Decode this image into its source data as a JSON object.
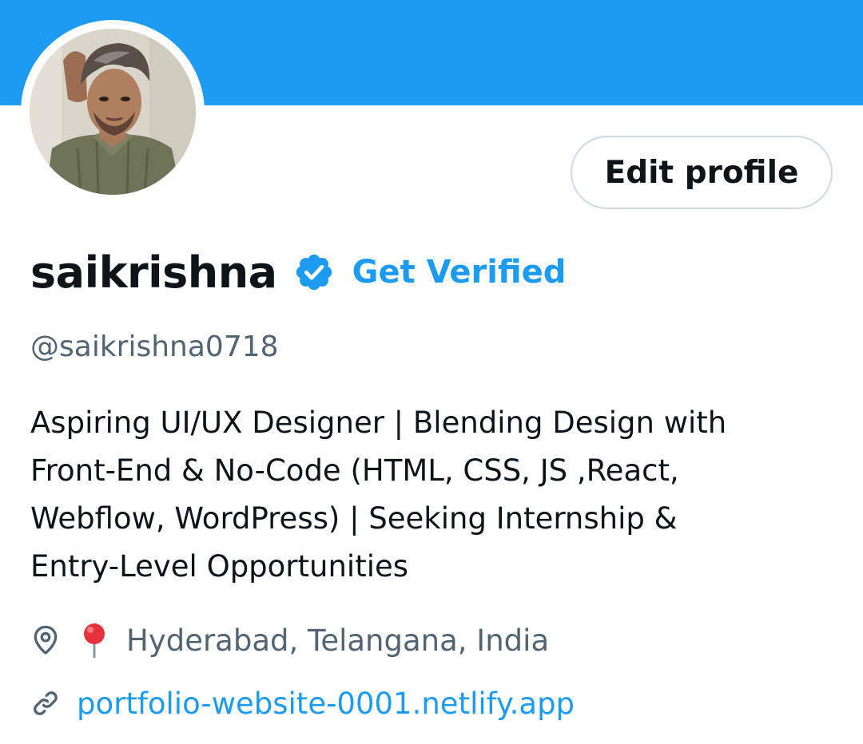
{
  "profile": {
    "display_name": "saikrishna",
    "get_verified_label": "Get Verified",
    "handle": "@saikrishna0718",
    "edit_profile_label": "Edit profile",
    "bio_lines": [
      "Aspiring UI/UX Designer | Blending Design with",
      "Front-End & No-Code (HTML, CSS, JS ,React,",
      "Webflow, WordPress) | Seeking Internship &",
      "Entry-Level Opportunities"
    ],
    "location": "Hyderabad, Telangana, India",
    "website": "portfolio-website-0001.netlify.app"
  },
  "icons": {
    "verified": "verified-badge-icon",
    "location": "location-pin-outline-icon",
    "location_emoji": "round-pushpin-emoji",
    "link": "link-chain-icon"
  },
  "colors": {
    "banner": "#1d9bf0",
    "accent": "#1d9bf0",
    "text_primary": "#0f1419",
    "text_secondary": "#536471",
    "border": "#cfd9de"
  }
}
